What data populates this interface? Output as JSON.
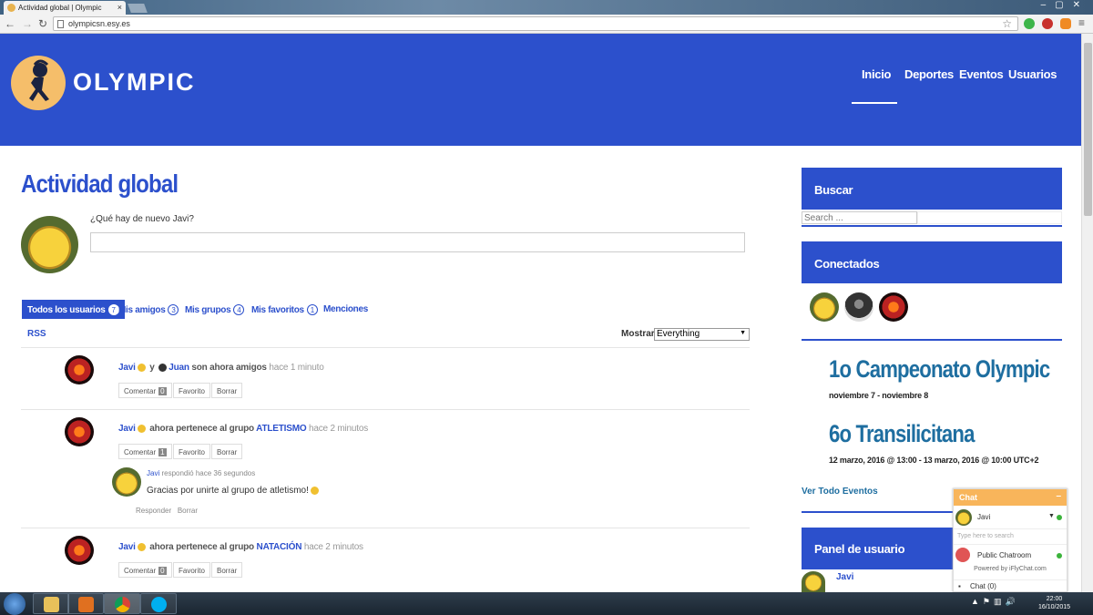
{
  "browser": {
    "tab_title": "Actividad global | Olympic",
    "url": "olympicsn.esy.es"
  },
  "site": {
    "logo_text": "OLYMPIC",
    "nav": [
      "Inicio",
      "Deportes",
      "Eventos",
      "Usuarios"
    ]
  },
  "main": {
    "page_title": "Actividad global",
    "whats_new": "¿Qué hay de nuevo Javi?",
    "tabs": [
      {
        "label": "Todos los usuarios",
        "count": "7"
      },
      {
        "label": "Mis amigos",
        "count": "3"
      },
      {
        "label": "Mis grupos",
        "count": "4"
      },
      {
        "label": "Mis favoritos",
        "count": "1"
      },
      {
        "label": "Menciones",
        "count": ""
      }
    ],
    "rss": "RSS",
    "show_label": "Mostrar:",
    "filter_value": "Everything",
    "activities": [
      {
        "user": "Javi",
        "and": "y",
        "other": "Juan",
        "text": "son ahora amigos",
        "time": "hace 1 minuto",
        "comment": "Comentar",
        "comment_count": "0",
        "favorite": "Favorito",
        "delete": "Borrar"
      },
      {
        "user": "Javi",
        "text": "ahora pertenece al grupo",
        "group": "ATLETISMO",
        "time": "hace 2 minutos",
        "comment": "Comentar",
        "comment_count": "1",
        "favorite": "Favorito",
        "delete": "Borrar",
        "reply": {
          "user": "Javi",
          "verb": "respondió",
          "time": "hace 36 segundos",
          "text": "Gracias por unirte al grupo de atletismo!",
          "reply_link": "Responder",
          "delete_link": "Borrar"
        }
      },
      {
        "user": "Javi",
        "text": "ahora pertenece al grupo",
        "group": "NATACIÓN",
        "time": "hace 2 minutos",
        "comment": "Comentar",
        "comment_count": "0",
        "favorite": "Favorito",
        "delete": "Borrar"
      }
    ]
  },
  "sidebar": {
    "search_title": "Buscar",
    "search_placeholder": "Search ...",
    "online_title": "Conectados",
    "events": [
      {
        "title": "1o Campeonato Olympic",
        "date": "noviembre 7 - noviembre 8"
      },
      {
        "title": "6o Transilicitana",
        "date": "12 marzo, 2016 @ 13:00 - 13 marzo, 2016 @ 10:00 UTC+2"
      }
    ],
    "all_events": "Ver Todo Eventos",
    "user_panel_title": "Panel de usuario",
    "user_name": "Javi"
  },
  "chat": {
    "title": "Chat",
    "minimize": "–",
    "user": "Javi",
    "search_placeholder": "Type here to search",
    "room": "Public Chatroom",
    "powered": "Powered by iFlyChat.com",
    "chat_count": "Chat (0)"
  },
  "taskbar": {
    "time": "22:00",
    "date": "16/10/2015"
  },
  "colors": {
    "brand_blue": "#2c50cc",
    "event_blue": "#1e6ea0",
    "chat_orange": "#f8b55b"
  }
}
